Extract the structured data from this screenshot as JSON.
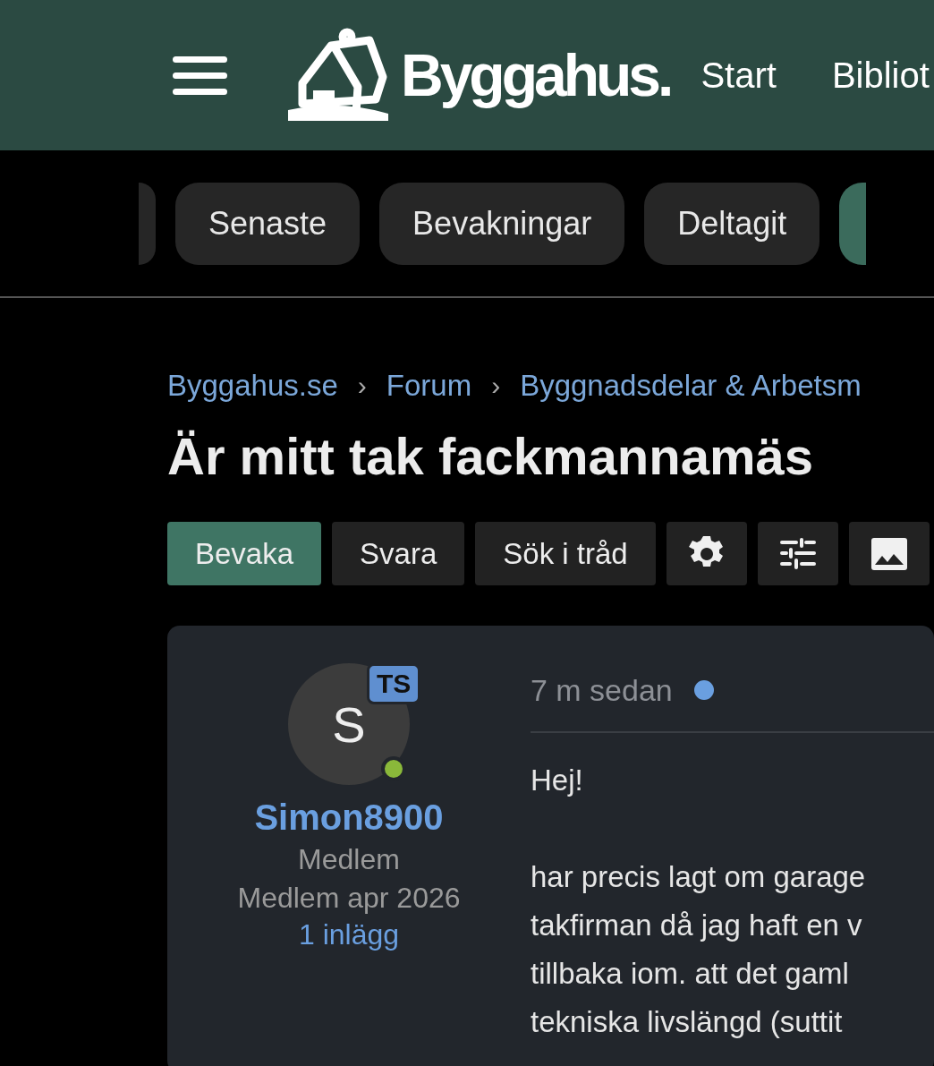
{
  "header": {
    "logo": "Byggahus.",
    "nav": [
      {
        "label": "Start"
      },
      {
        "label": "Bibliot"
      }
    ]
  },
  "tabs": [
    {
      "kind": "cut",
      "selected": false
    },
    {
      "kind": "pill",
      "label": "Senaste",
      "selected": false
    },
    {
      "kind": "pill",
      "label": "Bevakningar",
      "selected": false
    },
    {
      "kind": "pill",
      "label": "Deltagit",
      "selected": false
    },
    {
      "kind": "cut",
      "selected": true
    }
  ],
  "breadcrumb": [
    {
      "kind": "link",
      "text": "Byggahus.se"
    },
    {
      "kind": "separator",
      "text": "›"
    },
    {
      "kind": "link",
      "text": "Forum"
    },
    {
      "kind": "separator",
      "text": "›"
    },
    {
      "kind": "link",
      "text": "Byggnadsdelar & Arbetsm"
    }
  ],
  "thread": {
    "title": "Är mitt tak fackmannamäs",
    "actions": [
      {
        "kind": "text",
        "label": "Bevaka",
        "primary": true
      },
      {
        "kind": "text",
        "label": "Svara",
        "primary": false
      },
      {
        "kind": "text",
        "label": "Sök i tråd",
        "primary": false
      },
      {
        "kind": "settings",
        "primary": false
      },
      {
        "kind": "filter",
        "primary": false
      },
      {
        "kind": "media",
        "primary": false
      }
    ]
  },
  "post": {
    "author": {
      "initial": "S",
      "badge": "TS",
      "online": true,
      "name": "Simon8900",
      "role": "Medlem",
      "joined": "Medlem apr 2026",
      "posts": "1 inlägg"
    },
    "time": "7 m sedan",
    "unread": true,
    "paragraphs": [
      {
        "lines": [
          "Hej!"
        ]
      },
      {
        "lines": [
          "har precis lagt om garage",
          "takfirman då jag haft en v",
          "tillbaka iom. att det gaml",
          "tekniska livslängd (suttit"
        ]
      }
    ]
  }
}
